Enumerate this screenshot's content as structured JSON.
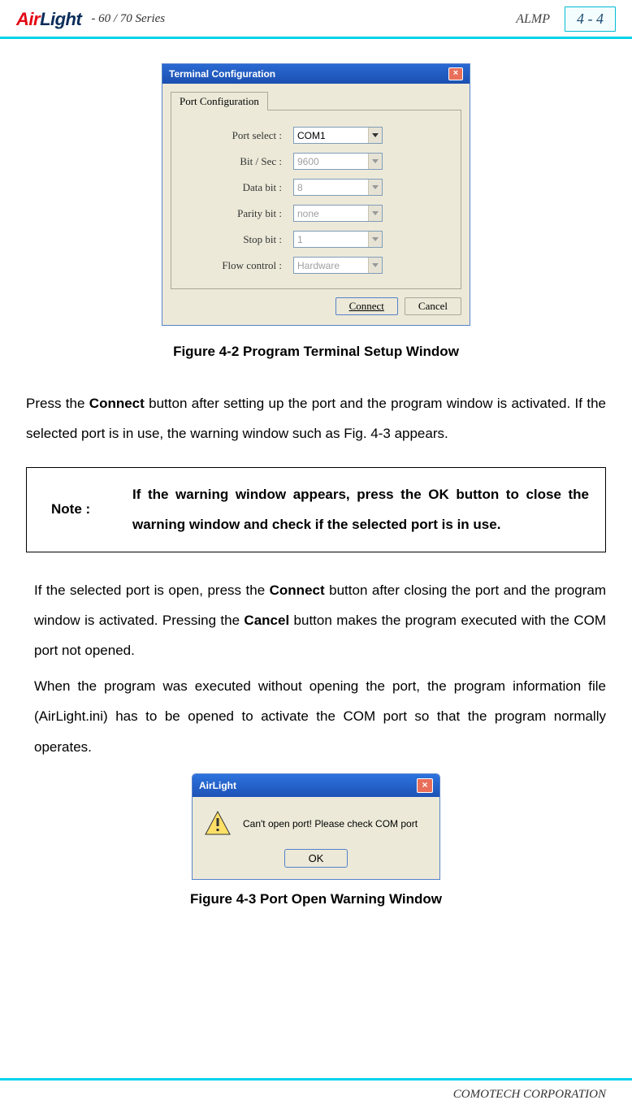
{
  "header": {
    "logo": {
      "part1": "Air",
      "part2": "Light"
    },
    "series": "- 60 / 70 Series",
    "almp": "ALMP",
    "page_num": "4 - 4"
  },
  "dialog1": {
    "title": "Terminal Configuration",
    "close": "×",
    "tab": "Port Configuration",
    "fields": {
      "port_select": {
        "label": "Port select  :",
        "value": "COM1"
      },
      "bit_sec": {
        "label": "Bit / Sec :",
        "value": "9600"
      },
      "data_bit": {
        "label": "Data bit :",
        "value": "8"
      },
      "parity_bit": {
        "label": "Parity bit :",
        "value": "none"
      },
      "stop_bit": {
        "label": "Stop bit :",
        "value": "1"
      },
      "flow_ctrl": {
        "label": "Flow control :",
        "value": "Hardware"
      }
    },
    "connect_btn": "Connect",
    "cancel_btn": "Cancel"
  },
  "fig1_caption": "Figure 4-2 Program Terminal Setup Window",
  "para1_before": "Press the ",
  "para1_bold": "Connect",
  "para1_after": " button after setting up the port and the program window is activated. If the selected port is in use, the warning window such as Fig. 4-3 appears.",
  "note": {
    "label": "Note :",
    "text": "If the warning window appears, press the OK button to close the warning window and check if the selected port is in use."
  },
  "para2a_1": "If the selected port is open, press the ",
  "para2a_b1": "Connect",
  "para2a_2": " button after closing the port and the program window is activated. Pressing the ",
  "para2a_b2": "Cancel",
  "para2a_3": " button makes the program executed with the COM port not opened.",
  "para2b": "When the program was executed without opening the port, the program information file (AirLight.ini) has to be opened to activate the COM port so that the program normally operates.",
  "dialog2": {
    "title": "AirLight",
    "close": "×",
    "message": "Can't open port! Please check COM port",
    "ok_btn": "OK"
  },
  "fig2_caption": "Figure 4-3 Port Open Warning Window",
  "footer": "COMOTECH CORPORATION"
}
